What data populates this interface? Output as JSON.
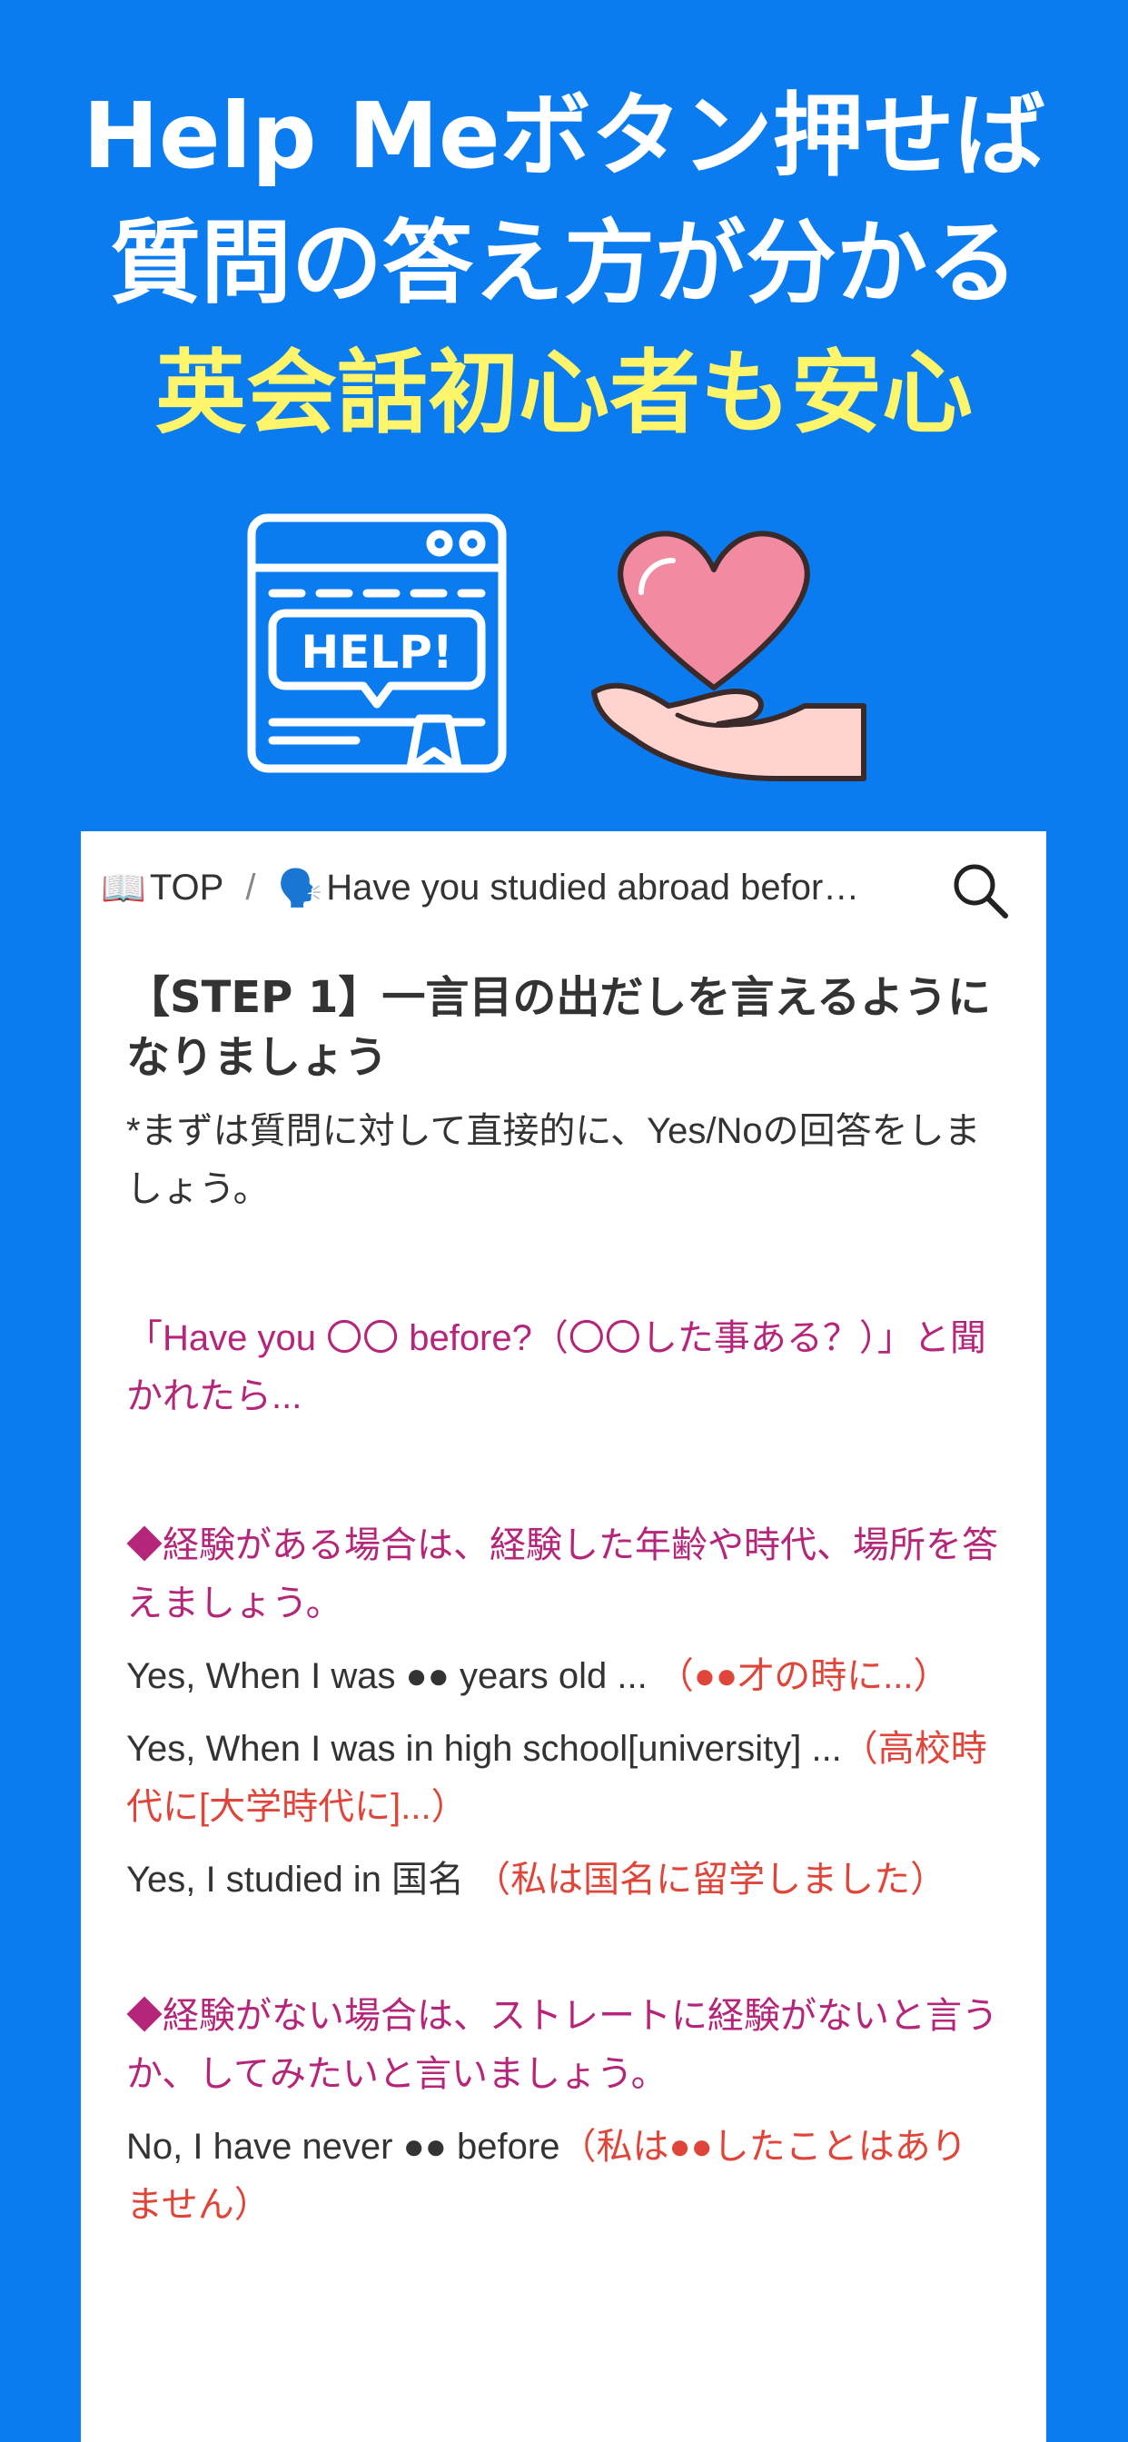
{
  "hero": {
    "line1": "Help Meボタン押せば",
    "line2": "質問の答え方が分かる",
    "line3": "英会話初心者も安心",
    "help_badge_text": "HELP!",
    "accent_color": "#fff56a",
    "bg_color": "#0a7cf0"
  },
  "breadcrumb": {
    "top_icon": "📖",
    "top_label": "TOP",
    "separator": "/",
    "question_icon": "🗣️",
    "question_label": "Have you studied abroad befor…"
  },
  "step": {
    "title": "【STEP 1】一言目の出だしを言えるようになりましょう",
    "intro": "*まずは質問に対して直接的に、Yes/Noの回答をしましょう。",
    "prompt": "「Have you 〇〇 before?（〇〇した事ある？）」と聞かれたら...",
    "yes_heading": "◆経験がある場合は、経験した年齢や時代、場所を答えましょう。",
    "yes_examples": [
      {
        "en": "Yes, When I was ●● years old ... ",
        "ja": "（●●才の時に...）"
      },
      {
        "en": "Yes, When I was in high school[university] ...",
        "ja": "（高校時代に[大学時代に]...）"
      },
      {
        "en": "Yes, I studied in 国名 ",
        "ja": "（私は国名に留学しました）"
      }
    ],
    "no_heading": "◆経験がない場合は、ストレートに経験がないと言うか、してみたいと言いましょう。",
    "no_examples": [
      {
        "en": "No, I have never ●● before",
        "ja": "（私は●●したことはありません）"
      }
    ]
  }
}
